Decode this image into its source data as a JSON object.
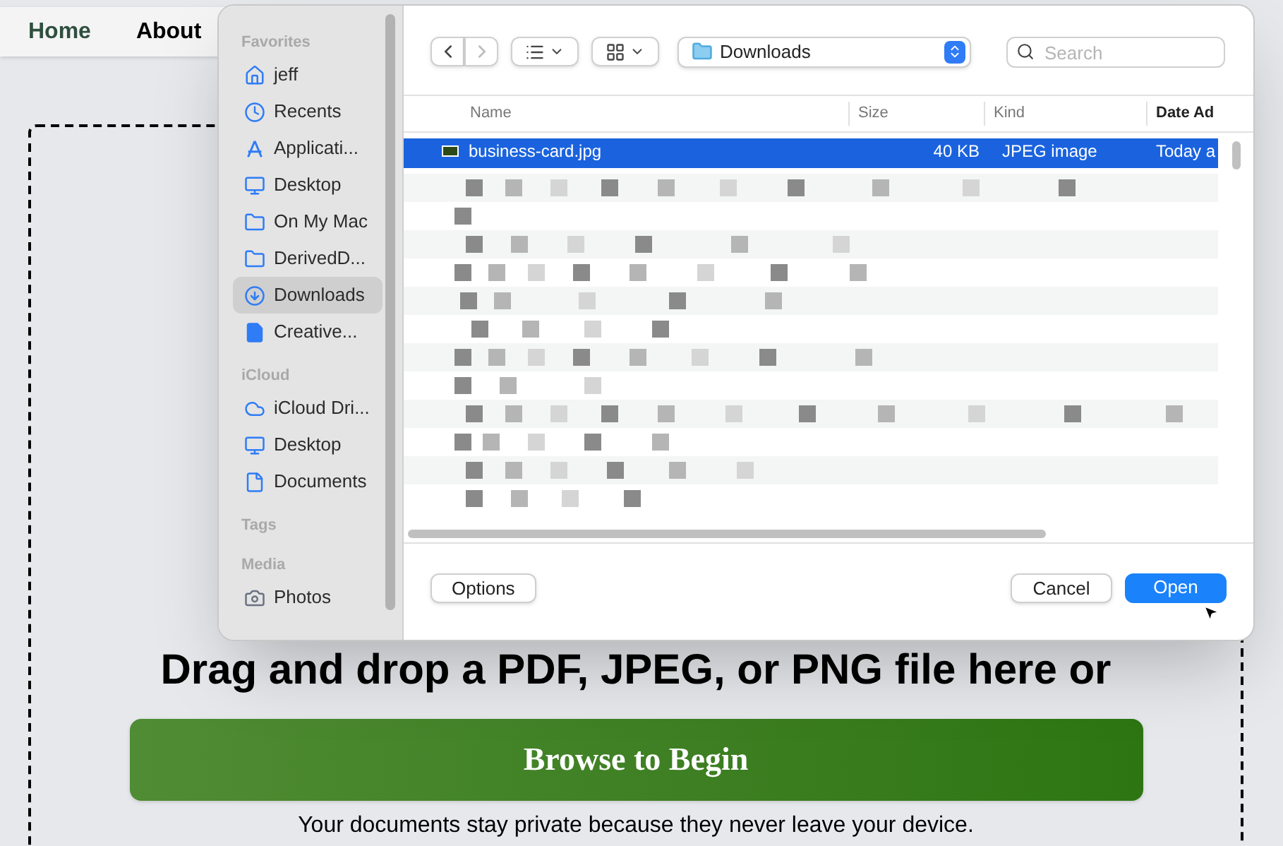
{
  "nav": {
    "items": [
      {
        "label": "Home",
        "selected": true
      },
      {
        "label": "About",
        "selected": false
      }
    ]
  },
  "dropzone": {
    "heading": "Drag and drop a PDF, JPEG, or PNG file here or",
    "button": "Browse to Begin",
    "note": "Your documents stay private because they never leave your device."
  },
  "dialog": {
    "sidebar": {
      "sections": [
        {
          "title": "Favorites",
          "items": [
            {
              "label": "jeff",
              "kind": "home",
              "selected": false
            },
            {
              "label": "Recents",
              "kind": "clock",
              "selected": false
            },
            {
              "label": "Applicati...",
              "kind": "apps",
              "selected": false
            },
            {
              "label": "Desktop",
              "kind": "desktop",
              "selected": false
            },
            {
              "label": "On My Mac",
              "kind": "folder",
              "selected": false
            },
            {
              "label": "DerivedD...",
              "kind": "folder",
              "selected": false
            },
            {
              "label": "Downloads",
              "kind": "download",
              "selected": true
            },
            {
              "label": "Creative...",
              "kind": "file",
              "selected": false
            }
          ]
        },
        {
          "title": "iCloud",
          "items": [
            {
              "label": "iCloud Dri...",
              "kind": "cloud",
              "selected": false
            },
            {
              "label": "Desktop",
              "kind": "desktop",
              "selected": false
            },
            {
              "label": "Documents",
              "kind": "document",
              "selected": false
            }
          ]
        },
        {
          "title": "Tags"
        },
        {
          "title": "Media",
          "items": [
            {
              "label": "Photos",
              "kind": "camera",
              "selected": false
            }
          ]
        }
      ]
    },
    "location": "Downloads",
    "search": {
      "placeholder": "Search"
    },
    "columns": [
      "Name",
      "Size",
      "Kind",
      "Date Ad"
    ],
    "rows": [
      {
        "name": "business-card.jpg",
        "size": "40 KB",
        "kind": "JPEG image",
        "date": "Today a",
        "selected": true
      }
    ],
    "buttons": {
      "options": "Options",
      "cancel": "Cancel",
      "open": "Open"
    }
  }
}
